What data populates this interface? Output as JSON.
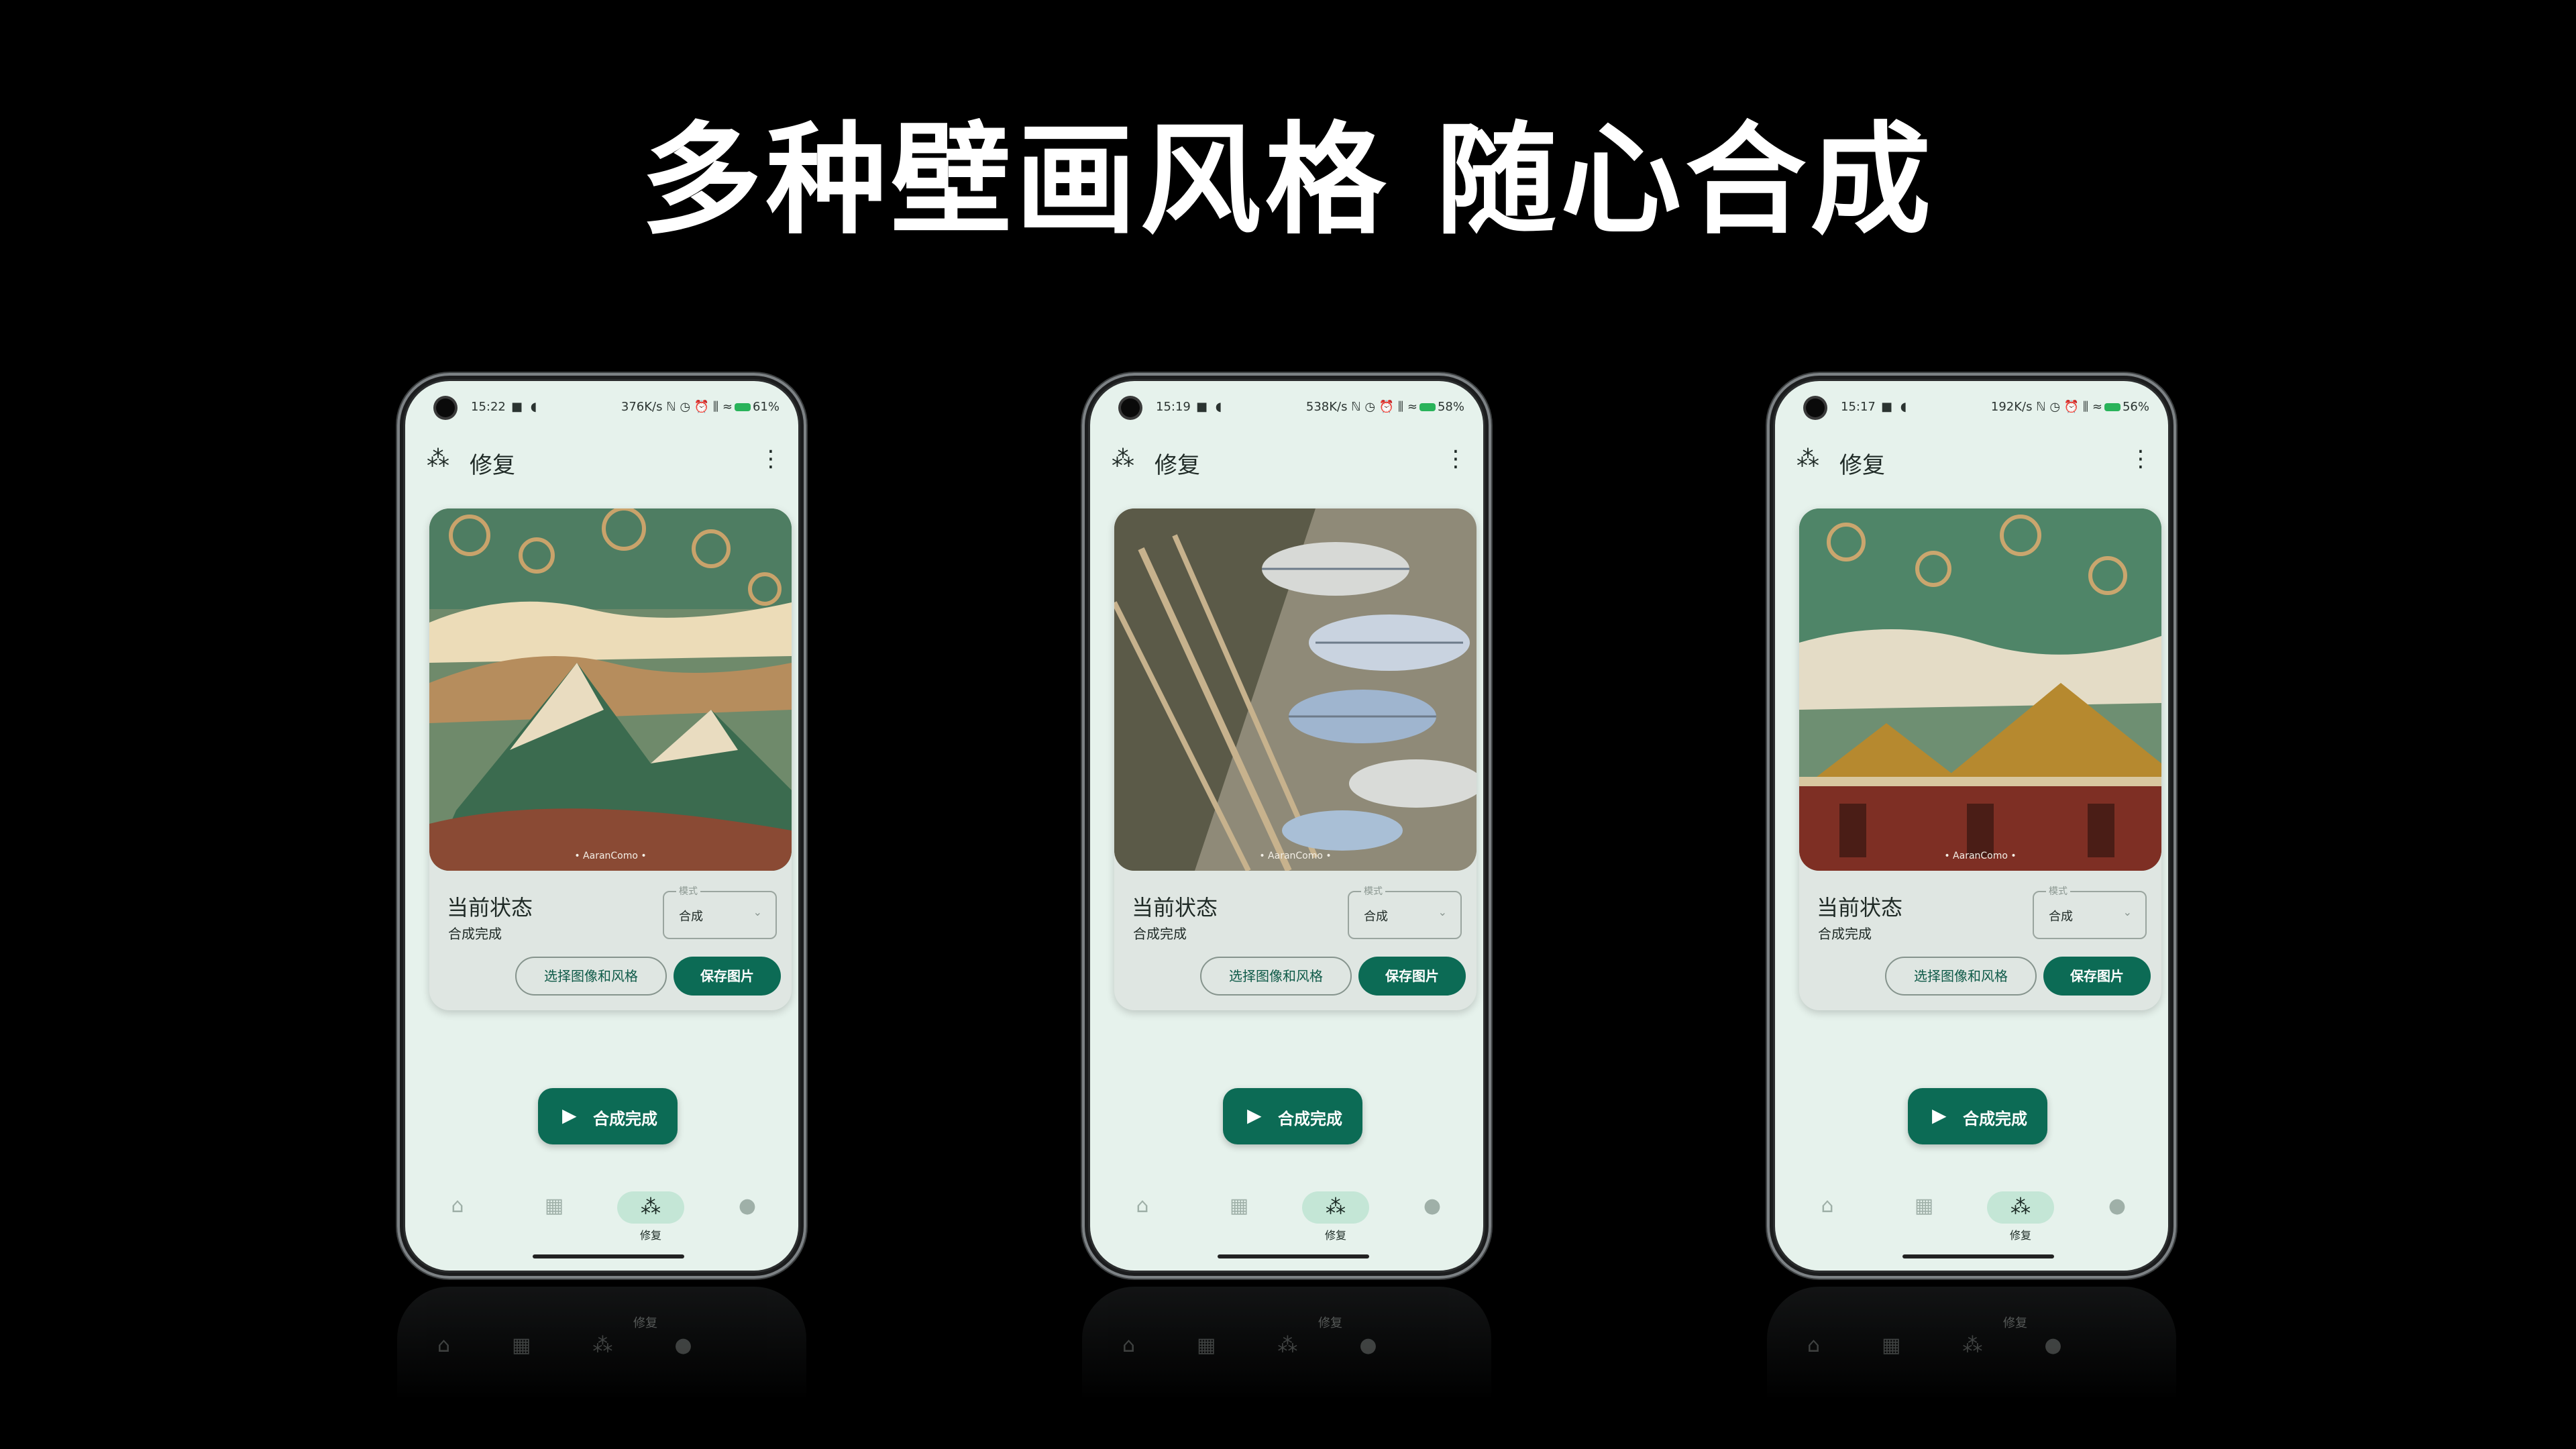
{
  "headline": "多种壁画风格 随心合成",
  "phones": [
    {
      "status": {
        "time": "15:22",
        "time_icons": "■ ◖",
        "right": "376K/s ℕ ◷ ⏰ ⫼ ≈",
        "battery": "61%"
      },
      "appbar": {
        "title": "修复",
        "wand_icon": "magic-wand-icon",
        "more_icon": "more-vert-icon"
      },
      "card": {
        "art_theme": "mountains",
        "art_watermark": "• AaranComo •",
        "state_title": "当前状态",
        "state_value": "合成完成",
        "mode_label": "模式",
        "mode_value": "合成",
        "select_button": "选择图像和风格",
        "save_button": "保存图片"
      },
      "fab": "合成完成",
      "nav": {
        "active_label": "修复"
      }
    },
    {
      "status": {
        "time": "15:19",
        "time_icons": "■ ◖",
        "right": "538K/s ℕ ◷ ⏰ ⫼ ≈",
        "battery": "58%"
      },
      "appbar": {
        "title": "修复",
        "wand_icon": "magic-wand-icon",
        "more_icon": "more-vert-icon"
      },
      "card": {
        "art_theme": "umbrellas",
        "art_watermark": "• AaranComo •",
        "state_title": "当前状态",
        "state_value": "合成完成",
        "mode_label": "模式",
        "mode_value": "合成",
        "select_button": "选择图像和风格",
        "save_button": "保存图片"
      },
      "fab": "合成完成",
      "nav": {
        "active_label": "修复"
      }
    },
    {
      "status": {
        "time": "15:17",
        "time_icons": "■ ◖",
        "right": "192K/s ℕ ◷ ⏰ ⫼ ≈",
        "battery": "56%"
      },
      "appbar": {
        "title": "修复",
        "wand_icon": "magic-wand-icon",
        "more_icon": "more-vert-icon"
      },
      "card": {
        "art_theme": "temple",
        "art_watermark": "• AaranComo •",
        "state_title": "当前状态",
        "state_value": "合成完成",
        "mode_label": "模式",
        "mode_value": "合成",
        "select_button": "选择图像和风格",
        "save_button": "保存图片"
      },
      "fab": "合成完成",
      "nav": {
        "active_label": "修复"
      }
    }
  ],
  "colors": {
    "accent": "#0c6b55",
    "screen_bg": "#e6f2ec",
    "card_bg": "#dfe6e2",
    "nav_pill": "#c4e6d6"
  }
}
